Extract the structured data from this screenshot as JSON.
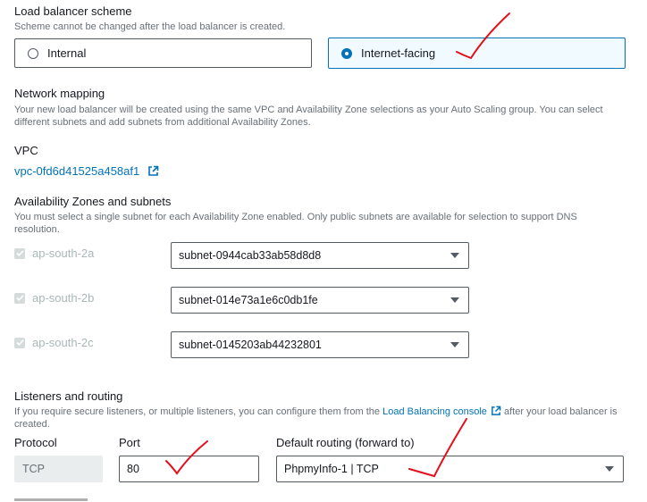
{
  "scheme": {
    "title": "Load balancer scheme",
    "description": "Scheme cannot be changed after the load balancer is created.",
    "options": [
      {
        "label": "Internal",
        "selected": false
      },
      {
        "label": "Internet-facing",
        "selected": true
      }
    ]
  },
  "network": {
    "title": "Network mapping",
    "description_line1": "Your new load balancer will be created using the same VPC and Availability Zone selections as your Auto Scaling group. You can select",
    "description_line2": "different subnets and add subnets from additional Availability Zones."
  },
  "vpc": {
    "title": "VPC",
    "link": "vpc-0fd6d41525a458af1",
    "link_icon": "external-link-icon"
  },
  "az": {
    "title": "Availability Zones and subnets",
    "description_line1": "You must select a single subnet for each Availability Zone enabled. Only public subnets are available for selection to support DNS",
    "description_line2": "resolution.",
    "zones": [
      {
        "name": "ap-south-2a",
        "subnet": "subnet-0944cab33ab58d8d8"
      },
      {
        "name": "ap-south-2b",
        "subnet": "subnet-014e73a1e6c0db1fe"
      },
      {
        "name": "ap-south-2c",
        "subnet": "subnet-0145203ab44232801"
      }
    ]
  },
  "listeners": {
    "title": "Listeners and routing",
    "description_before_link": "If you require secure listeners, or multiple listeners, you can configure them from the",
    "link": "Load Balancing console",
    "description_after_link": "after your load balancer is",
    "description_line2": "created.",
    "protocol_label": "Protocol",
    "protocol_value": "TCP",
    "port_label": "Port",
    "port_value": "80",
    "routing_label": "Default routing (forward to)",
    "routing_value": "PhpmyInfo-1 | TCP"
  },
  "colors": {
    "accent": "#0073bb",
    "annotation": "#e3101b"
  }
}
